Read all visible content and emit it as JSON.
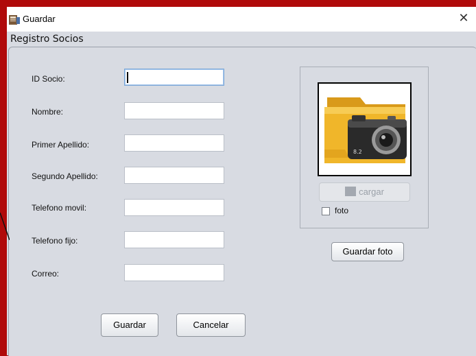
{
  "window": {
    "title": "Guardar",
    "close_symbol": "✕"
  },
  "form": {
    "frame_title": "Registro Socios",
    "fields": [
      {
        "label": "ID Socio:",
        "value": ""
      },
      {
        "label": "Nombre:",
        "value": ""
      },
      {
        "label": "Primer Apellido:",
        "value": ""
      },
      {
        "label": "Segundo Apellido:",
        "value": ""
      },
      {
        "label": "Telefono movil:",
        "value": ""
      },
      {
        "label": "Telefono fijo:",
        "value": ""
      },
      {
        "label": "Correo:",
        "value": ""
      }
    ],
    "save_label": "Guardar",
    "cancel_label": "Cancelar"
  },
  "photo": {
    "load_label": "cargar",
    "checkbox_label": "foto",
    "checkbox_checked": false,
    "save_photo_label": "Guardar foto"
  },
  "colors": {
    "background_accent": "#b00a0a",
    "window_bg": "#d8dbe2"
  }
}
